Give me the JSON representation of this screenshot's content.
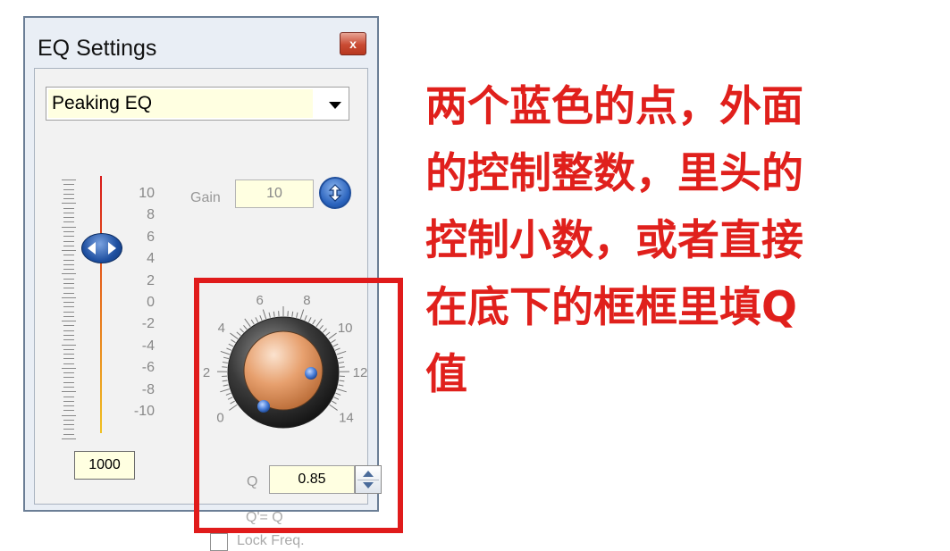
{
  "window": {
    "title": "EQ Settings",
    "close_glyph": "x",
    "filter_type": "Peaking EQ"
  },
  "slider": {
    "scale_labels": [
      "10",
      "8",
      "6",
      "4",
      "2",
      "0",
      "-2",
      "-4",
      "-6",
      "-8",
      "-10"
    ],
    "frequency": "1000"
  },
  "gain": {
    "label": "Gain",
    "value": "10"
  },
  "q_dial": {
    "scale_labels": [
      "0",
      "2",
      "4",
      "6",
      "8",
      "10",
      "12",
      "14"
    ],
    "q_label": "Q",
    "q_value": "0.85",
    "q_equals": "Q'=  Q"
  },
  "lock": {
    "label": "Lock Freq.",
    "checked": false
  },
  "annotation": {
    "lines": [
      "两个蓝色的点，外面",
      "的控制整数，里头的",
      "控制小数，或者直接",
      "在底下的框框里填Q",
      "值"
    ],
    "color": "#e0201c"
  },
  "colors": {
    "highlight_box": "#e01b1b",
    "field_background": "#ffffe1",
    "accent_blue": "#2a63bd"
  },
  "icons": {
    "close": "close-icon",
    "dropdown": "chevron-down-icon",
    "gain_toggle": "up-down-toggle-icon",
    "slider_thumb": "left-right-arrows-icon",
    "spin": "spin-up-down-icon"
  }
}
